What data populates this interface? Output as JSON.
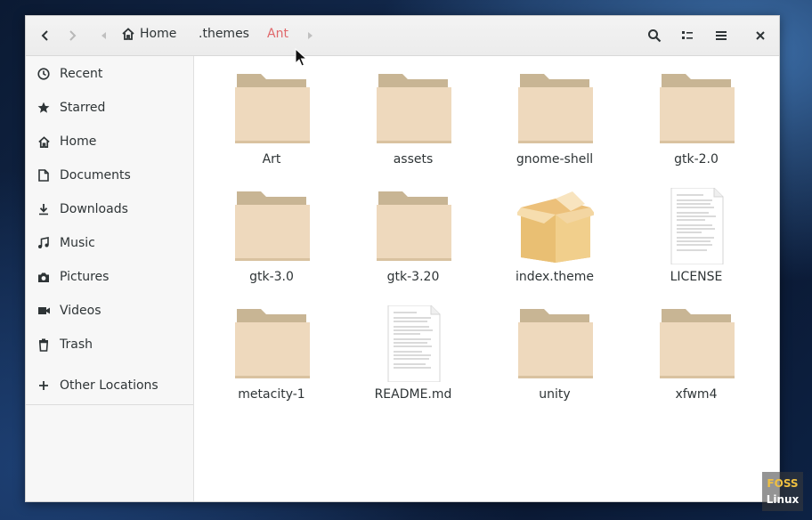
{
  "breadcrumb": [
    {
      "label": "Home",
      "icon": "home-icon"
    },
    {
      "label": ".themes"
    },
    {
      "label": "Ant",
      "active": true
    }
  ],
  "sidebar": {
    "items": [
      {
        "label": "Recent",
        "icon": "clock-icon"
      },
      {
        "label": "Starred",
        "icon": "star-icon"
      },
      {
        "label": "Home",
        "icon": "home-icon"
      },
      {
        "label": "Documents",
        "icon": "document-icon"
      },
      {
        "label": "Downloads",
        "icon": "download-icon"
      },
      {
        "label": "Music",
        "icon": "music-icon"
      },
      {
        "label": "Pictures",
        "icon": "camera-icon"
      },
      {
        "label": "Videos",
        "icon": "video-icon"
      },
      {
        "label": "Trash",
        "icon": "trash-icon"
      }
    ],
    "other": {
      "label": "Other Locations",
      "icon": "plus-icon"
    }
  },
  "files": [
    {
      "name": "Art",
      "type": "folder"
    },
    {
      "name": "assets",
      "type": "folder"
    },
    {
      "name": "gnome-shell",
      "type": "folder"
    },
    {
      "name": "gtk-2.0",
      "type": "folder"
    },
    {
      "name": "gtk-3.0",
      "type": "folder"
    },
    {
      "name": "gtk-3.20",
      "type": "folder"
    },
    {
      "name": "index.theme",
      "type": "package"
    },
    {
      "name": "LICENSE",
      "type": "text"
    },
    {
      "name": "metacity-1",
      "type": "folder"
    },
    {
      "name": "README.md",
      "type": "text"
    },
    {
      "name": "unity",
      "type": "folder"
    },
    {
      "name": "xfwm4",
      "type": "folder"
    }
  ],
  "watermark": {
    "line1": "FOSS",
    "line2": "Linux"
  },
  "colors": {
    "accent": "#e0686b",
    "folder_tab": "#c8b594",
    "folder_body": "#eed9bd"
  }
}
